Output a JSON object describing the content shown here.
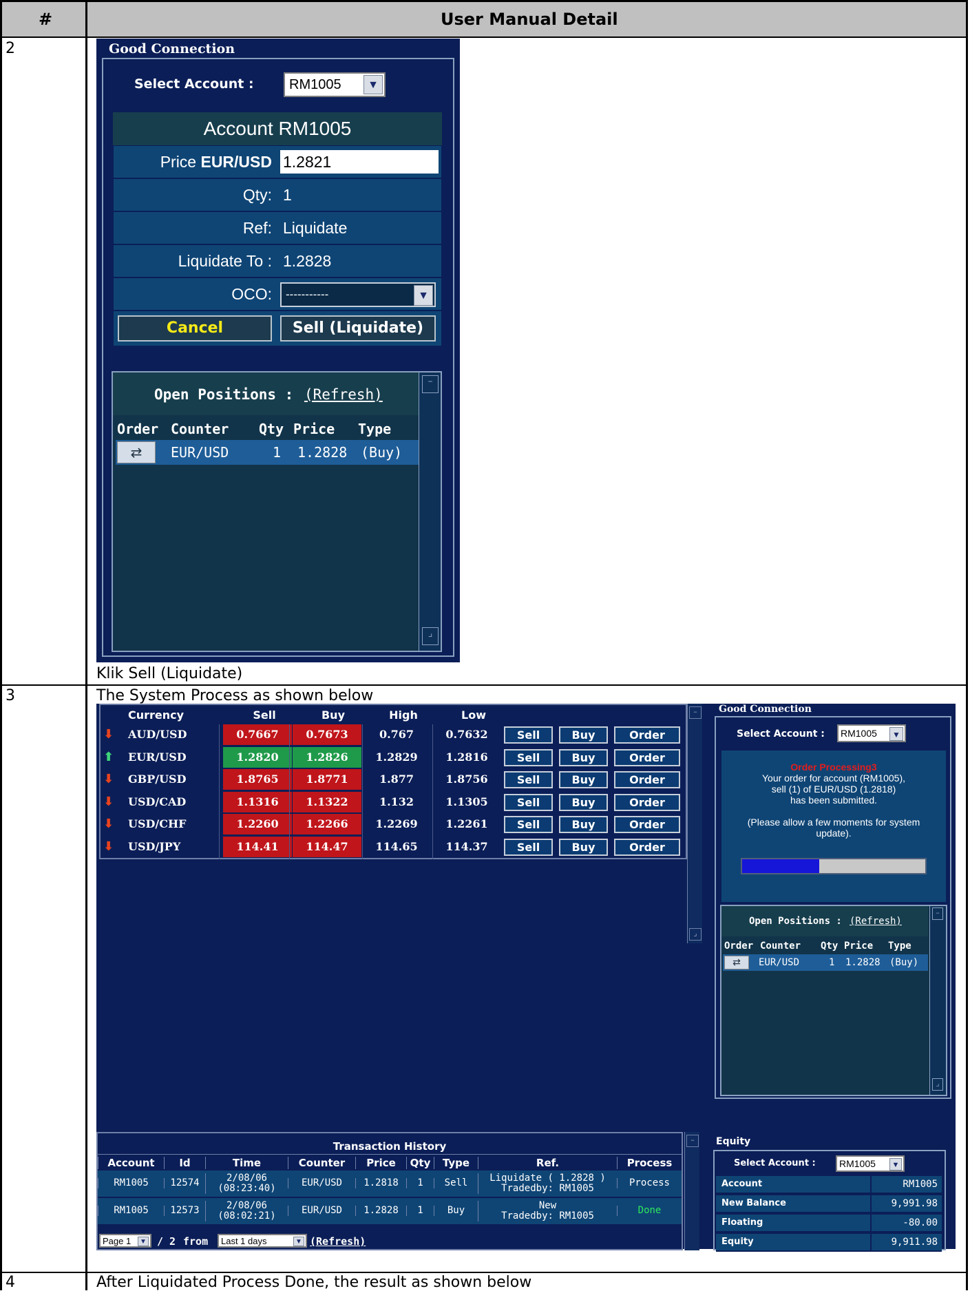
{
  "manual": {
    "header_num": "#",
    "header_detail": "User Manual Detail",
    "rows": [
      {
        "num": "2",
        "caption": "Klik Sell (Liquidate)"
      },
      {
        "num": "3",
        "caption": "The System Process as shown below"
      },
      {
        "num": "4",
        "caption": "After Liquidated Process Done, the result as shown below"
      }
    ]
  },
  "order_panel": {
    "status": "Good Connection",
    "select_account_label": "Select Account :",
    "select_account_value": "RM1005",
    "account_title": "Account RM1005",
    "price_label": "Price",
    "price_pair": "EUR/USD",
    "price_value": "1.2821",
    "qty_label": "Qty:",
    "qty_value": "1",
    "ref_label": "Ref:",
    "ref_value": "Liquidate",
    "liquidate_label": "Liquidate To :",
    "liquidate_value": "1.2828",
    "oco_label": "OCO:",
    "oco_value": "-----------",
    "cancel_label": "Cancel",
    "sell_label": "Sell (Liquidate)",
    "open_positions_label": "Open Positions :",
    "refresh_label": "(Refresh)",
    "columns": [
      "Order",
      "Counter",
      "Qty",
      "Price",
      "Type"
    ],
    "positions": [
      {
        "counter": "EUR/USD",
        "qty": "1",
        "price": "1.2828",
        "type": "(Buy)"
      }
    ]
  },
  "market": {
    "columns": [
      "Currency",
      "Sell",
      "Buy",
      "High",
      "Low"
    ],
    "rows": [
      {
        "pair": "AUD/USD",
        "dir": "down",
        "sell": "0.7667",
        "buy": "0.7673",
        "high": "0.767",
        "low": "0.7632"
      },
      {
        "pair": "EUR/USD",
        "dir": "up",
        "sell": "1.2820",
        "buy": "1.2826",
        "high": "1.2829",
        "low": "1.2816"
      },
      {
        "pair": "GBP/USD",
        "dir": "down",
        "sell": "1.8765",
        "buy": "1.8771",
        "high": "1.877",
        "low": "1.8756"
      },
      {
        "pair": "USD/CAD",
        "dir": "down",
        "sell": "1.1316",
        "buy": "1.1322",
        "high": "1.132",
        "low": "1.1305"
      },
      {
        "pair": "USD/CHF",
        "dir": "down",
        "sell": "1.2260",
        "buy": "1.2266",
        "high": "1.2269",
        "low": "1.2261"
      },
      {
        "pair": "USD/JPY",
        "dir": "down",
        "sell": "114.41",
        "buy": "114.47",
        "high": "114.65",
        "low": "114.37"
      }
    ],
    "sell_btn": "Sell",
    "buy_btn": "Buy",
    "order_btn": "Order"
  },
  "processing_panel": {
    "status": "Good Connection",
    "select_account_label": "Select Account :",
    "select_account_value": "RM1005",
    "processing_title": "Order Processing3",
    "msg_line1": "Your order for account (RM1005),",
    "msg_line2": "sell (1) of EUR/USD (1.2818)",
    "msg_line3": "has been submitted.",
    "msg_line4": "(Please allow a few moments for system",
    "msg_line5": "update).",
    "progress": 0.42,
    "open_positions_label": "Open Positions :",
    "refresh_label": "(Refresh)",
    "columns": [
      "Order",
      "Counter",
      "Qty",
      "Price",
      "Type"
    ],
    "positions": [
      {
        "counter": "EUR/USD",
        "qty": "1",
        "price": "1.2828",
        "type": "(Buy)"
      }
    ]
  },
  "history": {
    "title": "Transaction History",
    "columns": [
      "Account",
      "Id",
      "Time",
      "Counter",
      "Price",
      "Qty",
      "Type",
      "Ref.",
      "Process"
    ],
    "rows": [
      {
        "account": "RM1005",
        "id": "12574",
        "date": "2/08/06",
        "time": "(08:23:40)",
        "counter": "EUR/USD",
        "price": "1.2818",
        "qty": "1",
        "type": "Sell",
        "ref1": "Liquidate ( 1.2828 )",
        "ref2": "Tradedby: RM1005",
        "process": "Process"
      },
      {
        "account": "RM1005",
        "id": "12573",
        "date": "2/08/06",
        "time": "(08:02:21)",
        "counter": "EUR/USD",
        "price": "1.2828",
        "qty": "1",
        "type": "Buy",
        "ref1": "New",
        "ref2": "Tradedby: RM1005",
        "process": "Done"
      }
    ],
    "page_value": "Page 1",
    "page_of": "/ 2",
    "from_label": "from",
    "from_value": "Last 1 days",
    "refresh_label": "(Refresh)"
  },
  "equity": {
    "title": "Equity",
    "select_account_label": "Select Account :",
    "select_account_value": "RM1005",
    "rows": [
      {
        "key": "Account",
        "value": "RM1005"
      },
      {
        "key": "New Balance",
        "value": "9,991.98"
      },
      {
        "key": "Floating",
        "value": "-80.00"
      },
      {
        "key": "Equity",
        "value": "9,911.98"
      }
    ]
  },
  "colors": {
    "navy": "#0b1e57",
    "panel_blue": "#0f4575",
    "sell_red": "#c0151b",
    "buy_green": "#1f9a4a",
    "processing_red": "#e21d1d",
    "done_green": "#2ee85a"
  }
}
